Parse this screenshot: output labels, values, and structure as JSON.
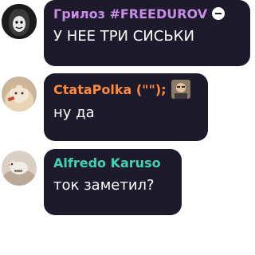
{
  "messages": [
    {
      "sender": "Грилоз #FREEDUROV",
      "sender_color": "#c98de6",
      "badge_icon": "minus-circle-icon",
      "text": "У НЕЕ ТРИ СИСЬКИ",
      "avatar_icon": "hooded-figure-avatar"
    },
    {
      "sender": "CtataPolka (\"\");",
      "sender_color": "#ff8a3d",
      "inline_avatar_icon": "person-mini-avatar",
      "text": "ну да",
      "avatar_icon": "cat-photo-avatar"
    },
    {
      "sender": "Alfredo Karuso",
      "sender_color": "#43d1b6",
      "text": "ток заметил?",
      "avatar_icon": "bird-photo-avatar"
    }
  ]
}
